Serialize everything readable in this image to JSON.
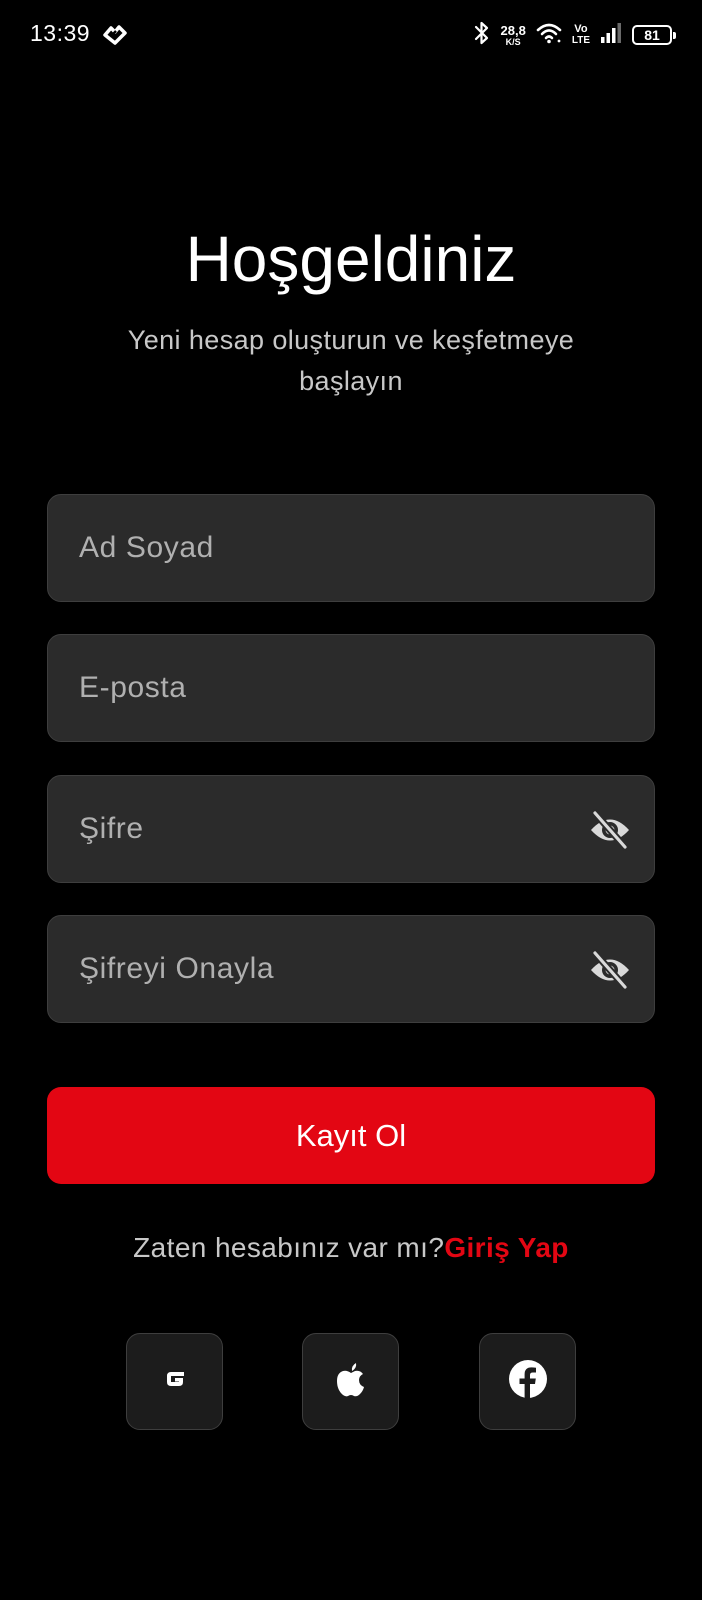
{
  "status_bar": {
    "time": "13:39",
    "network_speed_value": "28,8",
    "network_speed_unit": "K/S",
    "volte_top": "Vo",
    "volte_bottom": "LTE",
    "battery": "81",
    "icons": [
      "brand-logo-icon",
      "bluetooth-icon",
      "wifi-icon",
      "signal-icon",
      "battery-icon"
    ]
  },
  "header": {
    "title": "Hoşgeldiniz",
    "subtitle": "Yeni hesap oluşturun ve keşfetmeye başlayın"
  },
  "form": {
    "full_name_placeholder": "Ad Soyad",
    "email_placeholder": "E-posta",
    "password_placeholder": "Şifre",
    "confirm_password_placeholder": "Şifreyi Onayla",
    "password_toggle_icon": "eye-off-icon",
    "submit_label": "Kayıt Ol"
  },
  "login_prompt": {
    "text": "Zaten hesabınız var mı?",
    "link": "Giriş Yap"
  },
  "social": [
    {
      "provider": "google",
      "icon": "google-icon"
    },
    {
      "provider": "apple",
      "icon": "apple-icon"
    },
    {
      "provider": "facebook",
      "icon": "facebook-icon"
    }
  ],
  "colors": {
    "background": "#000000",
    "field_background": "#2b2b2b",
    "accent": "#e30613",
    "text_primary": "#ffffff",
    "text_secondary": "#c8c8c8"
  }
}
